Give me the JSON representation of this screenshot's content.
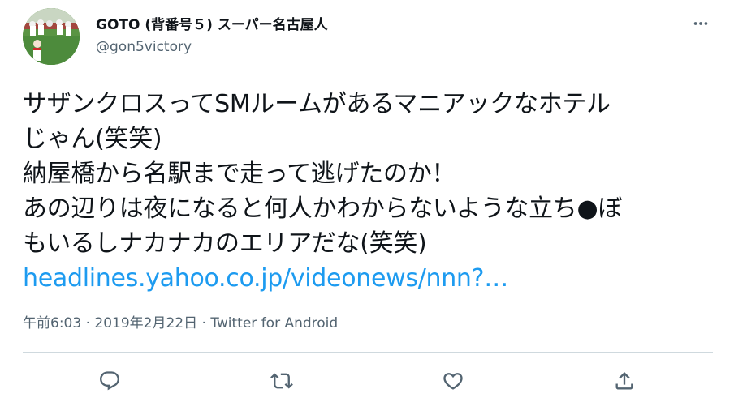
{
  "tweet": {
    "display_name": "GOTO (背番号５) スーパー名古屋人",
    "handle": "@gon5victory",
    "text_lines": [
      "サザンクロスってSMルームがあるマニアックなホテル",
      "じゃん(笑笑)",
      "納屋橋から名駅まで走って逃げたのか！",
      "あの辺りは夜になると何人かわからないような立ち●ぼ",
      "もいるしナカナカのエリアだな(笑笑)"
    ],
    "link_text": "headlines.yahoo.co.jp/videonews/nnn?…",
    "timestamp": "午前6:03 · 2019年2月22日 · ",
    "source": "Twitter for Android"
  },
  "icons": {
    "more": "more-horizontal-icon",
    "reply": "reply-icon",
    "retweet": "retweet-icon",
    "like": "like-icon",
    "share": "share-icon"
  },
  "colors": {
    "link": "#1d9bf0",
    "secondary_text": "#536471",
    "divider": "#cfd9de"
  }
}
